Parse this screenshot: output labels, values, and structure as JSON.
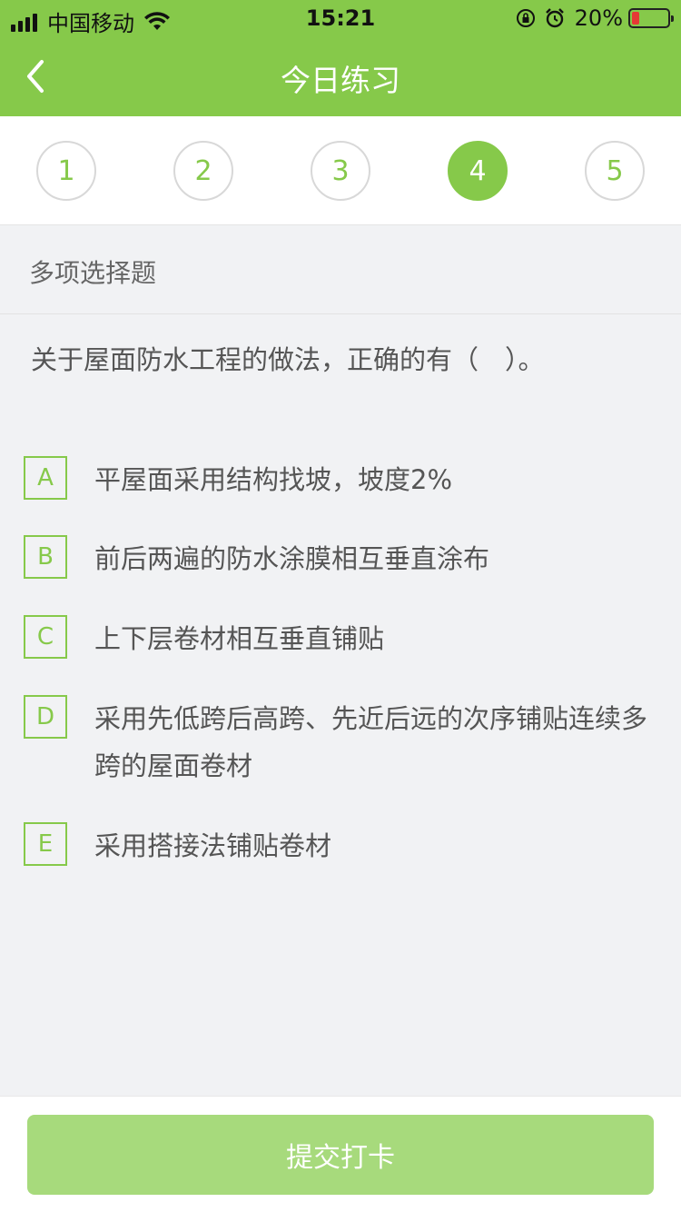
{
  "status_bar": {
    "carrier": "中国移动",
    "time": "15:21",
    "battery": "20%",
    "battery_level": 0.2,
    "battery_color": "#e53935"
  },
  "header": {
    "title": "今日练习",
    "back_icon": "chevron-left-icon",
    "background": "#86c94a"
  },
  "steps": {
    "items": [
      "1",
      "2",
      "3",
      "4",
      "5"
    ],
    "active_index": 3
  },
  "question": {
    "type": "多项选择题",
    "text": "关于屋面防水工程的做法，正确的有（　）。",
    "options": [
      {
        "letter": "A",
        "text": "平屋面采用结构找坡，坡度2%"
      },
      {
        "letter": "B",
        "text": "前后两遍的防水涂膜相互垂直涂布"
      },
      {
        "letter": "C",
        "text": "上下层卷材相互垂直铺贴"
      },
      {
        "letter": "D",
        "text": "采用先低跨后高跨、先近后远的次序铺贴连续多跨的屋面卷材"
      },
      {
        "letter": "E",
        "text": "采用搭接法铺贴卷材"
      }
    ]
  },
  "footer": {
    "submit_label": "提交打卡",
    "submit_color": "#a7da7c"
  }
}
